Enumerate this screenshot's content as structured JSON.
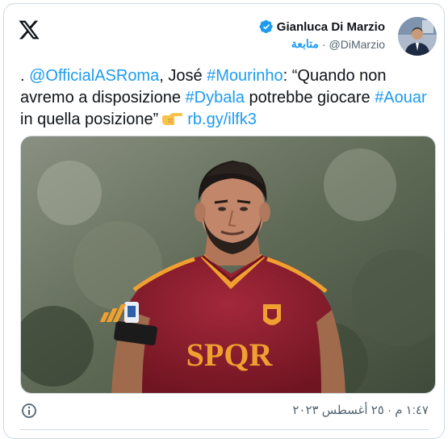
{
  "header": {
    "logo": "x-logo-icon",
    "author": {
      "display_name": "Gianluca Di Marzio",
      "verified_icon": "verified-badge-icon",
      "follow_label": "متابعة",
      "separator": "·",
      "handle": "@DiMarzio"
    }
  },
  "tweet": {
    "prefix": ".",
    "mention": "@OfficialASRoma",
    "text1": ", José",
    "hashtag_mourinho": "#Mourinho",
    "text2": ": “Quando non avremo a disposizione",
    "hashtag_dybala": "#Dybala",
    "text3": "potrebbe giocare",
    "hashtag_aouar": "#Aouar",
    "text4": "in quella posizione”",
    "emoji_icon": "backhand-index-pointing-right-icon",
    "link": "rb.gy/ilfk3"
  },
  "media": {
    "jersey_text": "SPQR",
    "icons": [
      "adidas-logo-icon",
      "roma-crest-icon",
      "serie-a-patch-icon"
    ]
  },
  "footer": {
    "info_icon": "info-icon",
    "timestamp": "١:٤٧ م · ٢٥ أغسطس ٢٠٢٣"
  },
  "colors": {
    "accent": "#1d9bf0",
    "text": "#0f1419",
    "muted": "#536471",
    "jersey": "#8c1d2b",
    "jersey_trim": "#f0a030"
  }
}
